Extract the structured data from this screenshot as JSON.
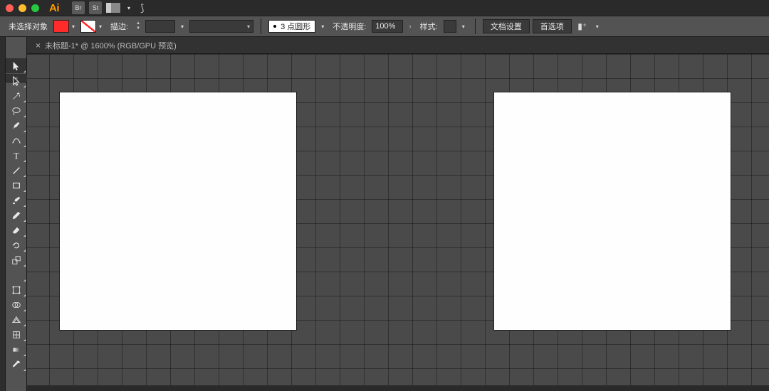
{
  "colors": {
    "fill_swatch": "#ff2a2a",
    "style_swatch": "#ffffff"
  },
  "titlebar": {
    "app_logo": "Ai",
    "quick_apps": [
      "Br",
      "St"
    ]
  },
  "controlbar": {
    "selection_label": "未选择对象",
    "stroke_label": "描边:",
    "stroke_value": "",
    "stroke_weight_value": "",
    "brush_label": "3 点圆形",
    "opacity_label": "不透明度:",
    "opacity_value": "100%",
    "style_label": "样式:",
    "doc_setup_btn": "文档设置",
    "prefs_btn": "首选项"
  },
  "document": {
    "tab_title": "未标题-1* @ 1600% (RGB/GPU 预览)"
  },
  "tools": {
    "collapse_glyph": "«",
    "items": [
      {
        "name": "selection-tool",
        "active": true
      },
      {
        "name": "direct-selection-tool"
      },
      {
        "name": "magic-wand-tool"
      },
      {
        "name": "lasso-tool"
      },
      {
        "name": "pen-tool"
      },
      {
        "name": "curvature-tool"
      },
      {
        "name": "type-tool"
      },
      {
        "name": "line-segment-tool"
      },
      {
        "name": "rectangle-tool"
      },
      {
        "name": "paintbrush-tool"
      },
      {
        "name": "pencil-tool"
      },
      {
        "name": "eraser-tool"
      },
      {
        "name": "rotate-tool"
      },
      {
        "name": "scale-tool"
      },
      {
        "name": "width-tool"
      },
      {
        "name": "free-transform-tool"
      },
      {
        "name": "shape-builder-tool"
      },
      {
        "name": "perspective-grid-tool"
      },
      {
        "name": "mesh-tool"
      },
      {
        "name": "gradient-tool"
      },
      {
        "name": "eyedropper-tool"
      }
    ]
  }
}
